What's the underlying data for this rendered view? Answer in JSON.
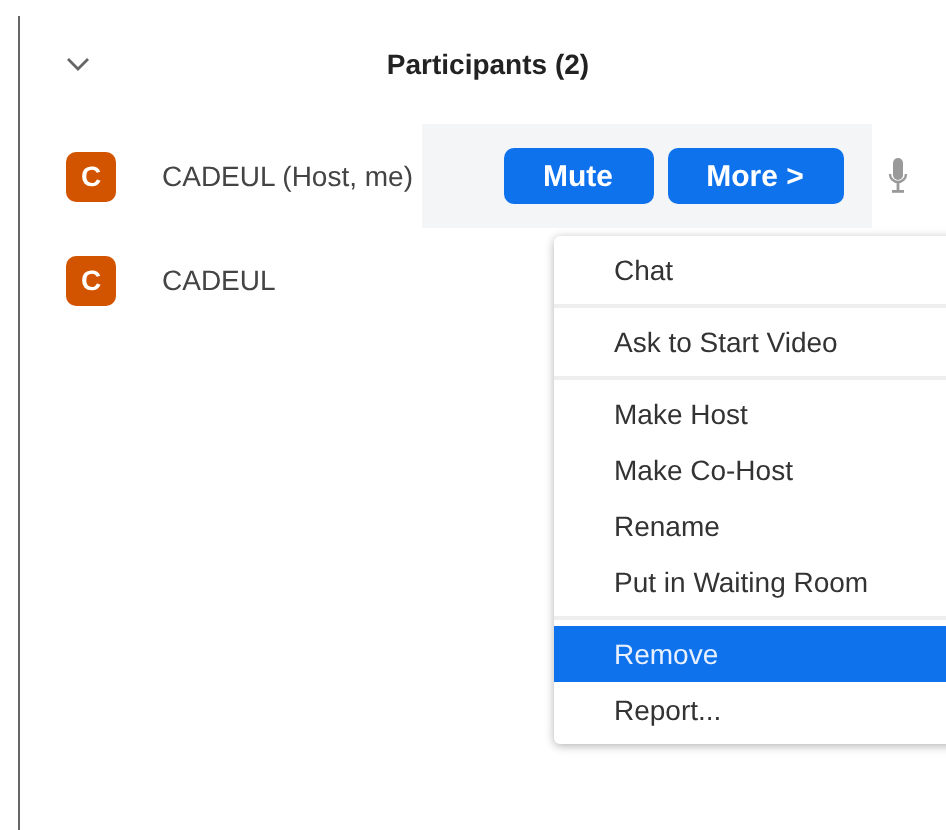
{
  "header": {
    "title": "Participants (2)"
  },
  "participants": [
    {
      "initial": "C",
      "name": "CADEUL (Host, me)",
      "actions": [
        "Mute",
        "More >"
      ]
    },
    {
      "initial": "C",
      "name": "CADEUL"
    }
  ],
  "menu": {
    "groups": [
      {
        "items": [
          {
            "label": "Chat",
            "selected": false
          }
        ]
      },
      {
        "items": [
          {
            "label": "Ask to Start Video",
            "selected": false
          }
        ]
      },
      {
        "items": [
          {
            "label": "Make Host",
            "selected": false
          },
          {
            "label": "Make Co-Host",
            "selected": false
          },
          {
            "label": "Rename",
            "selected": false
          },
          {
            "label": "Put in Waiting Room",
            "selected": false
          }
        ]
      },
      {
        "items": [
          {
            "label": "Remove",
            "selected": true
          },
          {
            "label": "Report...",
            "selected": false
          }
        ]
      }
    ]
  }
}
